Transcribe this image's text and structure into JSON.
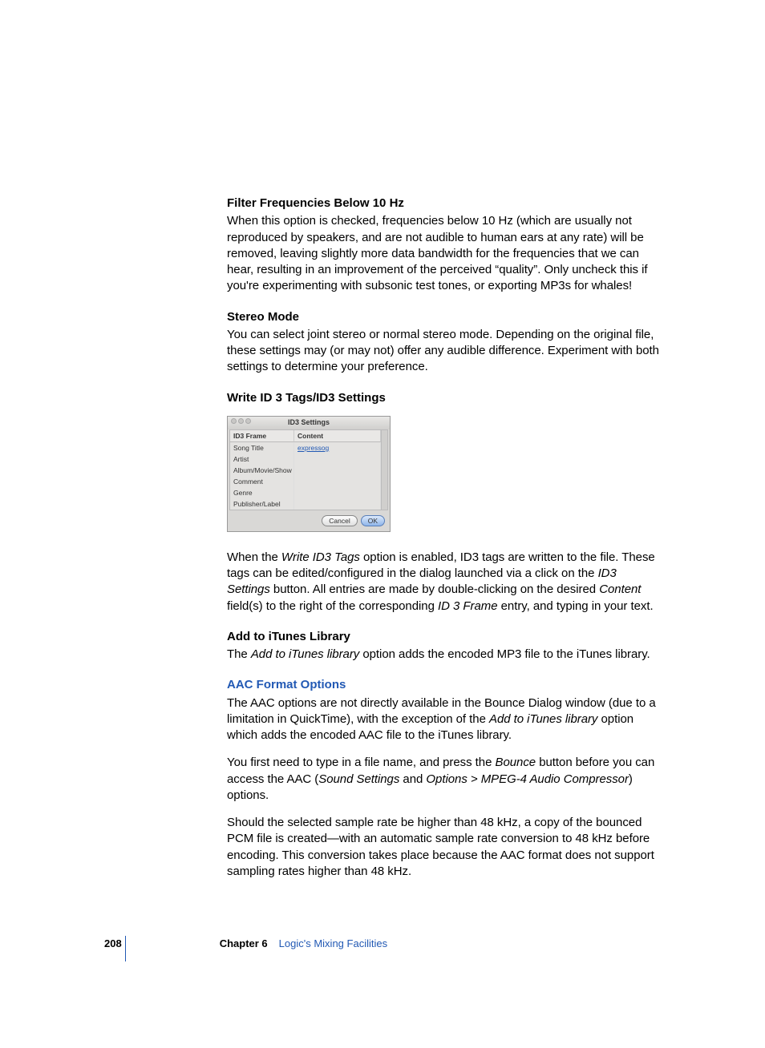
{
  "sections": {
    "filter": {
      "heading": "Filter Frequencies Below 10 Hz",
      "body": "When this option is checked, frequencies below 10 Hz (which are usually not reproduced by speakers, and are not audible to human ears at any rate) will be removed, leaving slightly more data bandwidth for the frequencies that we can hear, resulting in an improvement of the perceived “quality”. Only uncheck this if you're experimenting with subsonic test tones, or exporting MP3s for whales!"
    },
    "stereo": {
      "heading": "Stereo Mode",
      "body": "You can select joint stereo or normal stereo mode. Depending on the original file, these settings may (or may not) offer any audible difference. Experiment with both settings to determine your preference."
    },
    "id3": {
      "heading": "Write ID 3 Tags/ID3 Settings",
      "p1a": "When the ",
      "p1i1": "Write ID3 Tags",
      "p1b": " option is enabled, ID3 tags are written to the file. These tags can be edited/configured in the dialog launched via a click on the ",
      "p1i2": "ID3 Settings",
      "p1c": " button. All entries are made by double-clicking on the desired ",
      "p1i3": "Content",
      "p1d": " field(s) to the right of the corresponding ",
      "p1i4": "ID 3 Frame",
      "p1e": " entry, and typing in your text."
    },
    "itunes": {
      "heading": "Add to iTunes Library",
      "p1a": "The ",
      "p1i1": "Add to iTunes library",
      "p1b": " option adds the encoded MP3 file to the iTunes library."
    },
    "aac": {
      "heading": "AAC Format Options",
      "p1a": "The AAC options are not directly available in the Bounce Dialog window (due to a limitation in QuickTime), with the exception of the ",
      "p1i1": "Add to iTunes library",
      "p1b": " option which adds the encoded AAC file to the iTunes library.",
      "p2a": "You first need to type in a file name, and press the ",
      "p2i1": "Bounce",
      "p2b": " button before you can access the AAC (",
      "p2i2": "Sound Settings",
      "p2c": " and ",
      "p2i3": "Options > MPEG-4 Audio Compressor",
      "p2d": ") options.",
      "p3": "Should the selected sample rate be higher than 48 kHz, a copy of the bounced PCM file is created—with an automatic sample rate conversion to 48 kHz before encoding. This conversion takes place because the AAC format does not support sampling rates higher than 48 kHz."
    }
  },
  "dialog": {
    "title": "ID3 Settings",
    "col1": "ID3 Frame",
    "col2": "Content",
    "rows": [
      "Song Title",
      "Artist",
      "Album/Movie/Show",
      "Comment",
      "Genre",
      "Publisher/Label"
    ],
    "value": "expressog",
    "cancel": "Cancel",
    "ok": "OK"
  },
  "footer": {
    "page": "208",
    "chapter_label": "Chapter 6",
    "chapter_title": "Logic's Mixing Facilities"
  }
}
